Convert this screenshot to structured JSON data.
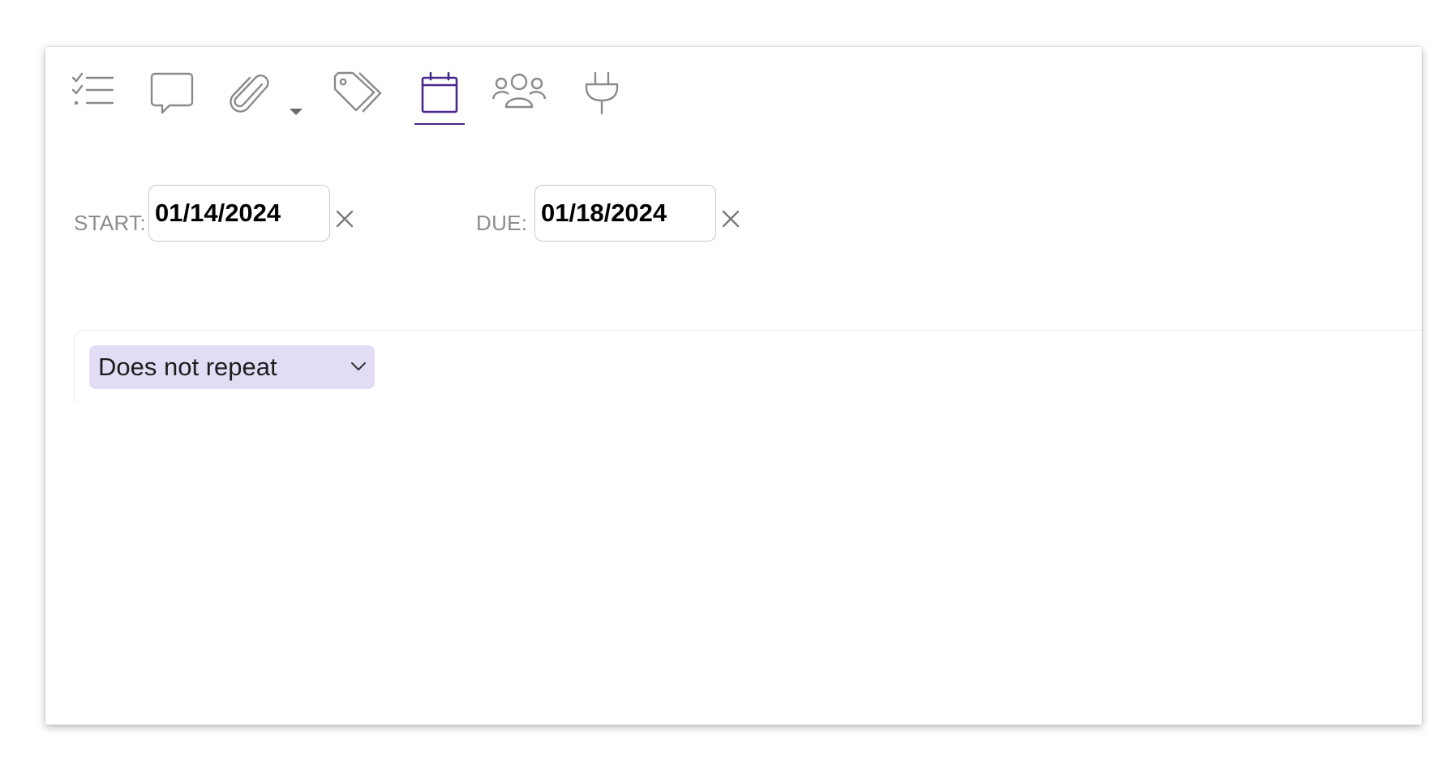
{
  "toolbar": {
    "items": [
      {
        "icon": "checklist-icon",
        "label": "Checklist"
      },
      {
        "icon": "comment-icon",
        "label": "Comments"
      },
      {
        "icon": "paperclip-icon",
        "label": "Attachments"
      },
      {
        "icon": "tag-icon",
        "label": "Tags"
      },
      {
        "icon": "calendar-icon",
        "label": "Dates",
        "active": true
      },
      {
        "icon": "people-icon",
        "label": "Members"
      },
      {
        "icon": "plug-icon",
        "label": "Integrations"
      }
    ],
    "active_color": "#4a2a8a",
    "icon_color": "#8a8a8a"
  },
  "dates": {
    "start_label": "START:",
    "start_value": "01/14/2024",
    "due_label": "DUE:",
    "due_value": "01/18/2024",
    "clear_icon": "close-icon"
  },
  "repeat": {
    "selected": "Does not repeat",
    "background": "#e2dcf4"
  }
}
